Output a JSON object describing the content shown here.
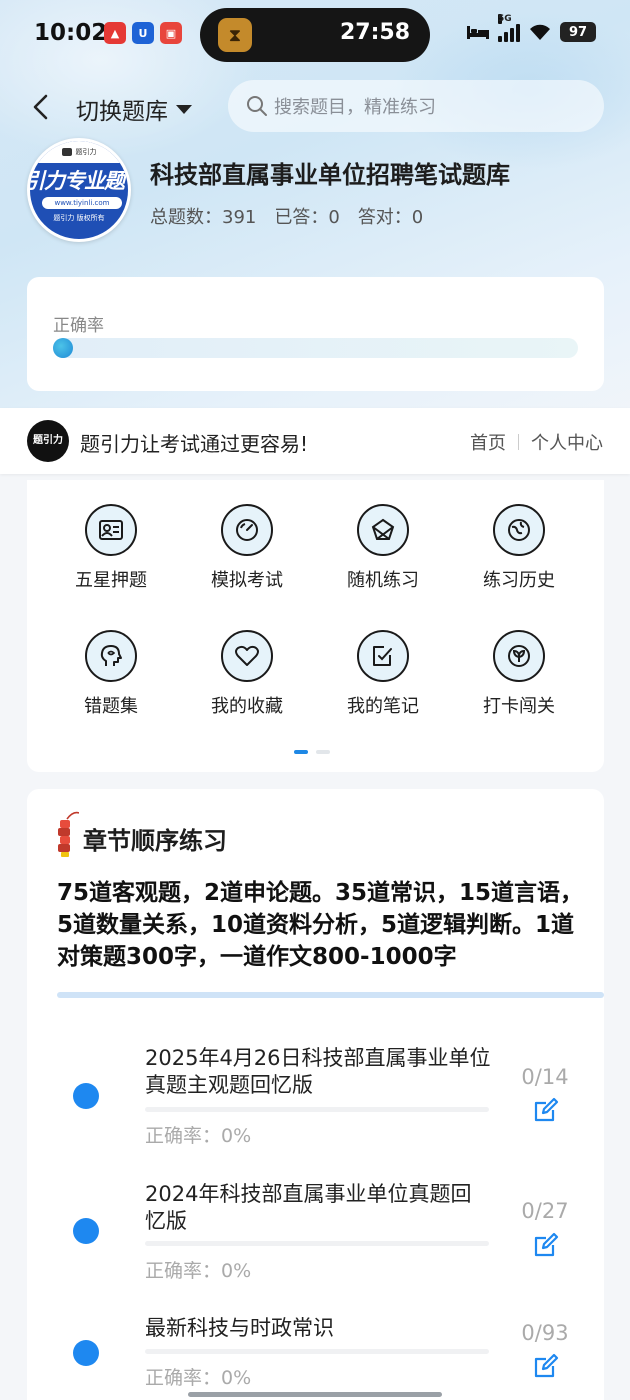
{
  "status_bar": {
    "time": "10:02",
    "timer": "27:58",
    "network": "5G",
    "battery": "97"
  },
  "header": {
    "switch_label": "切换题库",
    "search_placeholder": "搜索题目，精准练习"
  },
  "bank": {
    "logo_text": "引力专业题",
    "logo_top": "题引力",
    "logo_url": "www.tiyinli.com",
    "logo_footer": "题引力 版权所有",
    "title": "科技部直属事业单位招聘笔试题库",
    "total": "总题数：391",
    "answered": "已答：0",
    "correct": "答对：0"
  },
  "accuracy": {
    "label": "正确率",
    "value": 0
  },
  "promo": {
    "logo_text": "题引力",
    "slogan": "题引力让考试通过更容易!",
    "link_home": "首页",
    "link_profile": "个人中心"
  },
  "menu": [
    {
      "label": "五星押题",
      "icon": "id-card-icon"
    },
    {
      "label": "模拟考试",
      "icon": "gauge-icon"
    },
    {
      "label": "随机练习",
      "icon": "shuffle-icon"
    },
    {
      "label": "练习历史",
      "icon": "history-icon"
    },
    {
      "label": "错题集",
      "icon": "head-icon"
    },
    {
      "label": "我的收藏",
      "icon": "heart-icon"
    },
    {
      "label": "我的笔记",
      "icon": "note-icon"
    },
    {
      "label": "打卡闯关",
      "icon": "leaf-icon"
    }
  ],
  "pager": {
    "pages": 2,
    "current": 1
  },
  "chapter": {
    "title": "章节顺序练习",
    "description": "75道客观题，2道申论题。35道常识，15道言语，5道数量关系，10道资料分析，5道逻辑判断。1道对策题300字，一道作文800-1000字",
    "items": [
      {
        "name": "2025年4月26日科技部直属事业单位真题主观题回忆版",
        "count": "0/14",
        "accuracy": "正确率：0%"
      },
      {
        "name": "2024年科技部直属事业单位真题回忆版",
        "count": "0/27",
        "accuracy": "正确率：0%"
      },
      {
        "name": "最新科技与时政常识",
        "count": "0/93",
        "accuracy": "正确率：0%"
      }
    ]
  },
  "colors": {
    "accent": "#1e88f0",
    "progress": "#1f8ad6"
  }
}
